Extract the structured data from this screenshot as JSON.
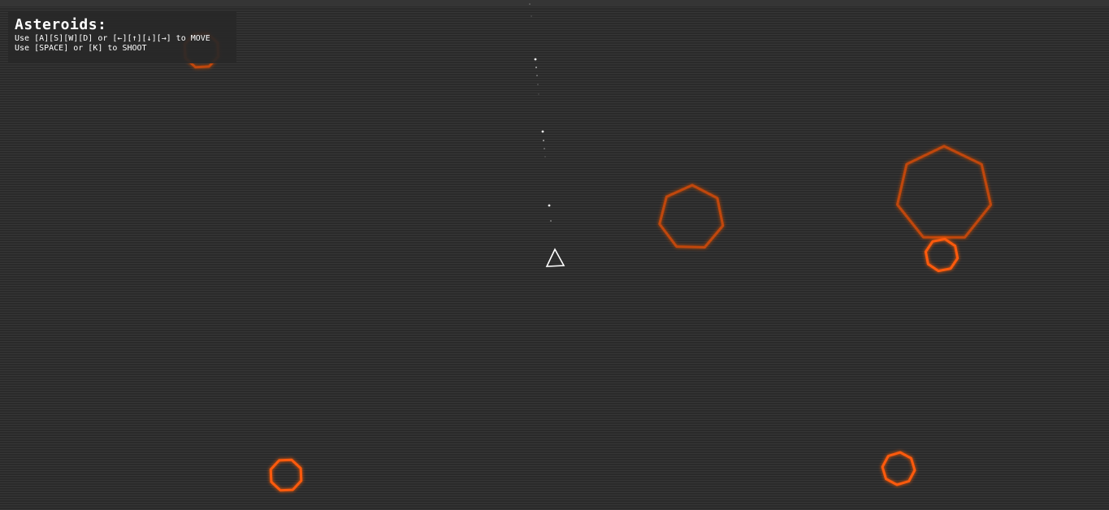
{
  "hud": {
    "title": "Asteroids:",
    "move_instructions": "Use [A][S][W][D] or [←][↑][↓][→] to MOVE",
    "shoot_instructions": "Use [SPACE] or [K] to SHOOT"
  },
  "colors": {
    "background": "#2f2f2f",
    "asteroid": "#ff5a0a",
    "asteroid_glow": "#c0460a",
    "ship": "#ffffff",
    "bullet": "#ffffff"
  },
  "objects": {
    "ship": {
      "icon": "ship-triangle-icon"
    },
    "asteroids": [
      {
        "icon": "asteroid-icon",
        "size": "small",
        "partially_hidden": true
      },
      {
        "icon": "asteroid-icon",
        "size": "medium"
      },
      {
        "icon": "asteroid-icon",
        "size": "large"
      },
      {
        "icon": "asteroid-icon",
        "size": "small"
      },
      {
        "icon": "asteroid-icon",
        "size": "small"
      },
      {
        "icon": "asteroid-icon",
        "size": "small"
      }
    ],
    "bullets": {
      "icon": "bullet-icon"
    }
  }
}
